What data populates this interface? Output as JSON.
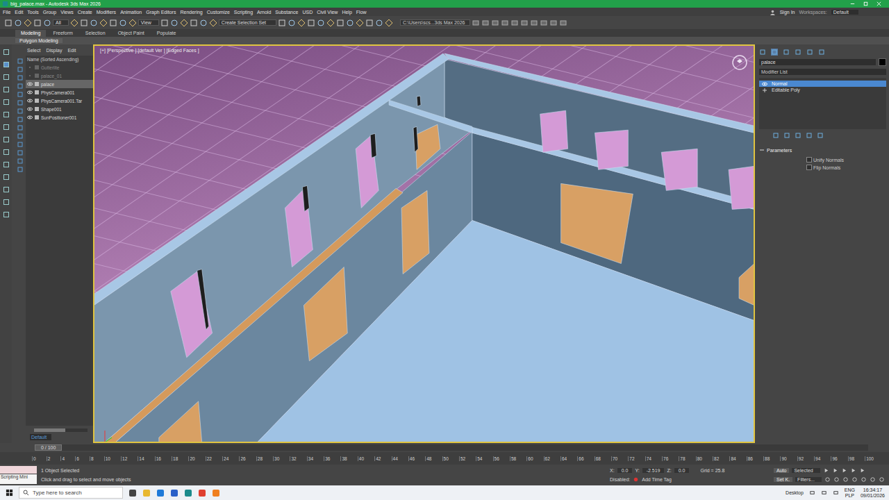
{
  "window": {
    "title": "big_palace.max - Autodesk 3ds Max 2026"
  },
  "menu": [
    "File",
    "Edit",
    "Tools",
    "Group",
    "Views",
    "Create",
    "Modifiers",
    "Animation",
    "Graph Editors",
    "Rendering",
    "Customize",
    "Scripting",
    "Arnold",
    "Substance",
    "USD",
    "Civil View",
    "Help",
    "Flow"
  ],
  "account": {
    "sign_in": "Sign In",
    "workspaces": "Workspaces:",
    "workspace": "Default"
  },
  "toolbar": {
    "filter": "All",
    "view": "View",
    "selection_set": "Create Selection Set",
    "project": "C:\\Users\\scs...3ds Max 2026"
  },
  "ribbon": {
    "tabs": [
      {
        "label": "Modeling",
        "selected": true
      },
      {
        "label": "Freeform",
        "selected": false
      },
      {
        "label": "Selection",
        "selected": false
      },
      {
        "label": "Object Paint",
        "selected": false
      },
      {
        "label": "Populate",
        "selected": false
      }
    ],
    "panel": "Polygon Modeling"
  },
  "explorer": {
    "tabs": [
      "Select",
      "Display",
      "Edit"
    ],
    "column": "Name (Sorted Ascending)",
    "items": [
      {
        "name": "Gutterlite",
        "dimmed": true,
        "selected": false
      },
      {
        "name": "palace_01",
        "dimmed": true,
        "selected": false
      },
      {
        "name": "palace",
        "dimmed": false,
        "selected": true
      },
      {
        "name": "PhysCamera001",
        "dimmed": false,
        "selected": false
      },
      {
        "name": "PhysCamera001.Tar",
        "dimmed": false,
        "selected": false
      },
      {
        "name": "Shape001",
        "dimmed": false,
        "selected": false
      },
      {
        "name": "SunPositioner001",
        "dimmed": false,
        "selected": false
      }
    ],
    "layer": "Default"
  },
  "viewport": {
    "label": "[+] [Perspective ] [default  Ver ] [Edged Faces ]"
  },
  "command_panel": {
    "object_name": "palace",
    "object_color": "#000000",
    "modifier_list": "Modifier List",
    "stack": [
      {
        "label": "Normal",
        "selected": true,
        "expandable": false
      },
      {
        "label": "Editable Poly",
        "selected": false,
        "expandable": true
      }
    ],
    "rollout": {
      "title": "Parameters",
      "expanded": true,
      "options": [
        {
          "label": "Unify Normals",
          "checked": false
        },
        {
          "label": "Flip Normals",
          "checked": false
        }
      ]
    }
  },
  "timeline": {
    "frame": "0 / 100",
    "level": 0,
    "ticks": [
      "0",
      "2",
      "4",
      "6",
      "8",
      "10",
      "12",
      "14",
      "16",
      "18",
      "20",
      "22",
      "24",
      "26",
      "28",
      "30",
      "32",
      "34",
      "36",
      "38",
      "40",
      "42",
      "44",
      "46",
      "48",
      "50",
      "52",
      "54",
      "56",
      "58",
      "60",
      "62",
      "64",
      "66",
      "68",
      "70",
      "72",
      "74",
      "76",
      "78",
      "80",
      "82",
      "84",
      "86",
      "88",
      "90",
      "92",
      "94",
      "96",
      "98",
      "100"
    ]
  },
  "status": {
    "maxscript": "Scripting Mini",
    "selection": "1 Object Selected",
    "prompt": "Click and drag to select and move objects",
    "x_label": "X:",
    "x": "0.0",
    "y_label": "Y:",
    "y": "-2.519",
    "z_label": "Z:",
    "z": "0.0",
    "grid": "Grid = 25.8",
    "disabled": "Disabled:",
    "time_tag": "Add Time Tag",
    "auto": "Auto",
    "set_key": "Set K.",
    "key_filter": "Selected",
    "filters": "Filters..."
  },
  "taskbar": {
    "search": "Type here to search",
    "desktop": "Desktop",
    "lang": "ENG",
    "layout": "PLP",
    "time": "16:34:17",
    "date": "09/01/2026"
  }
}
